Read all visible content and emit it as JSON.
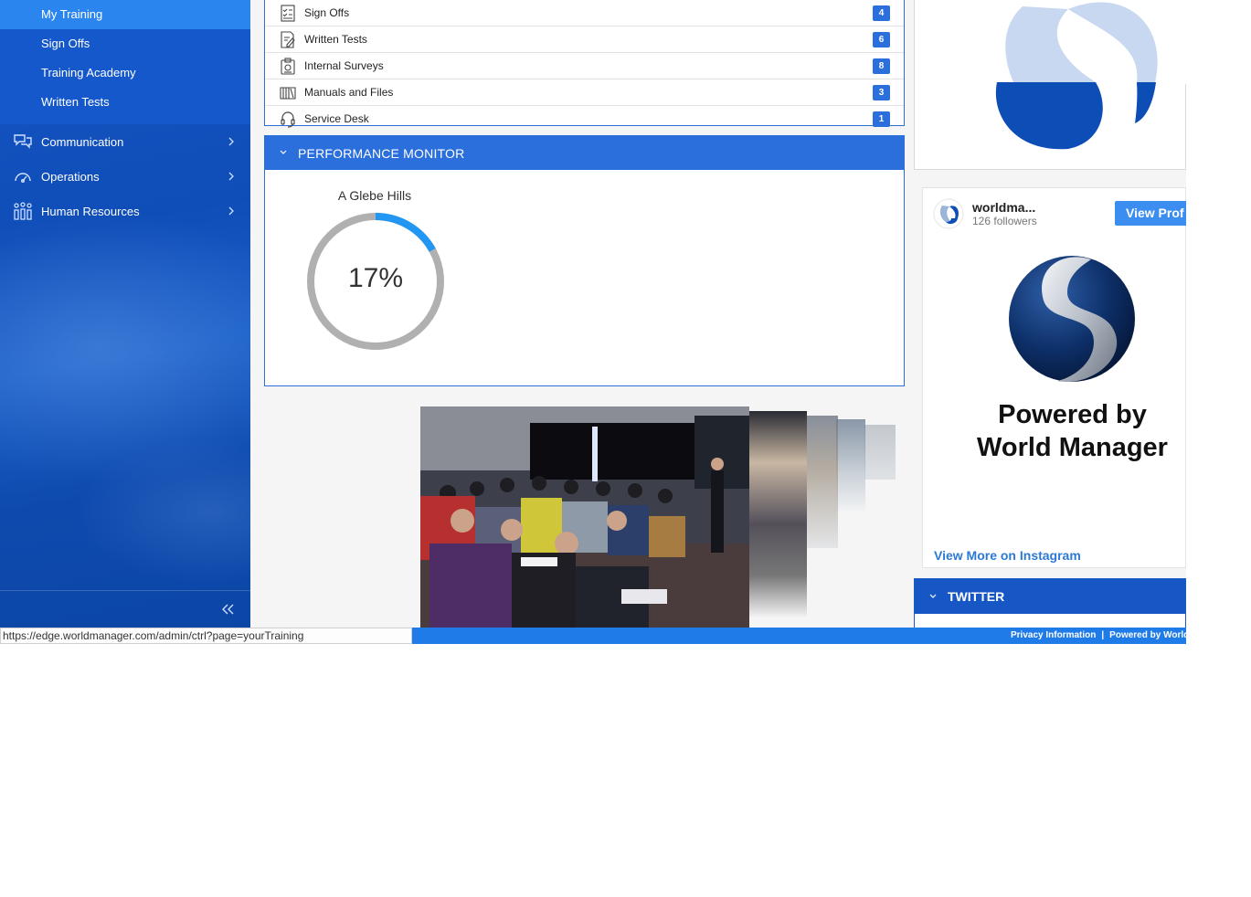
{
  "sidebar": {
    "submenu": [
      {
        "label": "My Training",
        "active": true
      },
      {
        "label": "Sign Offs",
        "active": false
      },
      {
        "label": "Training Academy",
        "active": false
      },
      {
        "label": "Written Tests",
        "active": false
      }
    ],
    "items": [
      {
        "label": "Communication",
        "icon": "chat-bubbles-icon"
      },
      {
        "label": "Operations",
        "icon": "speedometer-icon"
      },
      {
        "label": "Human Resources",
        "icon": "people-icon"
      }
    ],
    "collapse_icon": "double-chevron-left-icon"
  },
  "links": [
    {
      "label": "Sign Offs",
      "count": "4",
      "icon": "checklist-icon"
    },
    {
      "label": "Written Tests",
      "count": "6",
      "icon": "pencil-document-icon"
    },
    {
      "label": "Internal Surveys",
      "count": "8",
      "icon": "clipboard-icon"
    },
    {
      "label": "Manuals and Files",
      "count": "3",
      "icon": "books-icon"
    },
    {
      "label": "Service Desk",
      "count": "1",
      "icon": "headset-icon"
    }
  ],
  "performance": {
    "title": "PERFORMANCE MONITOR",
    "store": "A Glebe Hills",
    "value_text": "17%",
    "value_fraction": 0.17
  },
  "instagram": {
    "username": "worldma...",
    "followers": "126 followers",
    "view_profile": "View Prof",
    "powered_line1": "Powered by",
    "powered_line2": "World Manager",
    "view_more": "View More on Instagram"
  },
  "twitter": {
    "title": "TWITTER"
  },
  "footer": {
    "privacy": "Privacy Information",
    "separator": "|",
    "powered": "Powered by World M"
  },
  "status_url": "https://edge.worldmanager.com/admin/ctrl?page=yourTraining",
  "colors": {
    "primary": "#2b6fdc",
    "sidebar": "#0f4db8",
    "active": "#2a86ee",
    "gauge_fill": "#2196f3",
    "gauge_track": "#b0b0b0"
  }
}
